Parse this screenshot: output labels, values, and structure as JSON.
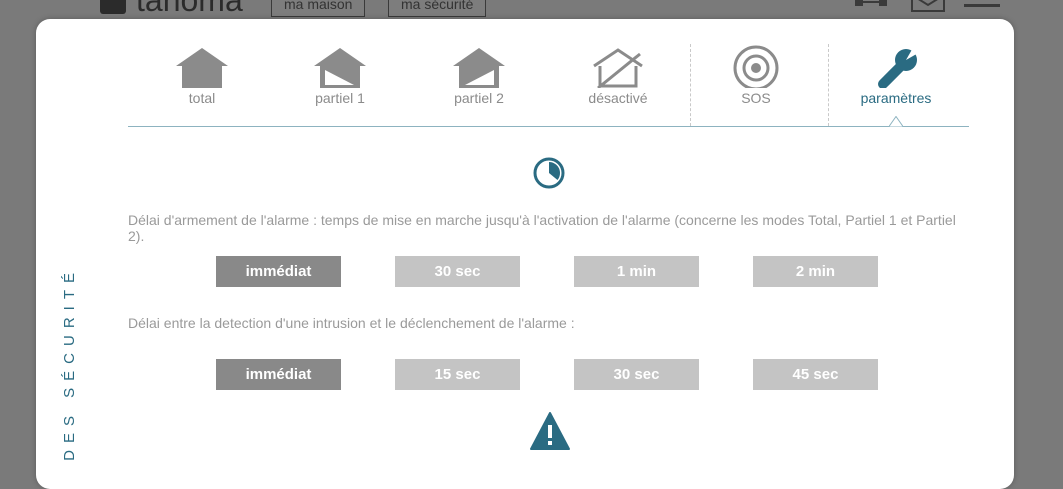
{
  "background": {
    "logo_text": "tahoma",
    "tabs": [
      "ma maison",
      "ma sécurité"
    ]
  },
  "side_title": "DES SÉCURITÉ",
  "mode_tabs": [
    {
      "label": "total",
      "icon": "house-full-icon"
    },
    {
      "label": "partiel 1",
      "icon": "house-partial-1-icon"
    },
    {
      "label": "partiel 2",
      "icon": "house-partial-2-icon"
    },
    {
      "label": "désactivé",
      "icon": "house-off-icon"
    },
    {
      "label": "SOS",
      "icon": "sos-target-icon"
    },
    {
      "label": "paramètres",
      "icon": "wrench-icon",
      "active": true
    }
  ],
  "settings": {
    "arming_delay": {
      "description": "Délai d'armement de l'alarme : temps de mise en marche jusqu'à l'activation de l'alarme (concerne les modes Total, Partiel 1 et Partiel 2).",
      "options": [
        "immédiat",
        "30 sec",
        "1 min",
        "2 min"
      ],
      "selected": "immédiat"
    },
    "trigger_delay": {
      "description": "Délai entre la detection d'une intrusion et le déclenchement de l'alarme :",
      "options": [
        "immédiat",
        "15 sec",
        "30 sec",
        "45 sec"
      ],
      "selected": "immédiat"
    }
  },
  "colors": {
    "accent": "#2a6b82",
    "tab_inactive": "#8b8b8b",
    "option_selected": "#898989",
    "option_default": "#c4c4c4",
    "overlay": "#7a7a7a"
  }
}
